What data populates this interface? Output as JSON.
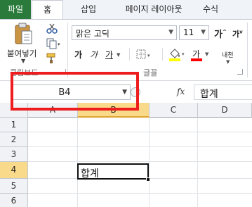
{
  "tabs": [
    "파일",
    "홈",
    "삽입",
    "페이지 레이아웃",
    "수식"
  ],
  "clipboard": {
    "paste_label": "붙여넣기",
    "group_label": "클립보드"
  },
  "font": {
    "name": "맑은 고딕",
    "size": "11",
    "bold_label": "가",
    "italic_label": "가",
    "underline_label": "가",
    "font_color_label": "가",
    "phonetic_label": "내천",
    "group_label": "글꼴"
  },
  "formula_bar": {
    "name_box": "B4",
    "fx_label": "fx",
    "content": "합계"
  },
  "grid": {
    "columns": [
      "A",
      "B",
      "C",
      "D"
    ],
    "rows": [
      "1",
      "2",
      "3",
      "4",
      "5",
      "6"
    ],
    "selected_column": "B",
    "selected_row": "4",
    "active_cell_value": "합계"
  },
  "colors": {
    "file_tab": "#2a7a3b",
    "highlight": "#ee1c1c",
    "selected_header": "#f9d98a",
    "font_color_bar": "#ff0000",
    "fill_color_bar": "#ffff00"
  }
}
